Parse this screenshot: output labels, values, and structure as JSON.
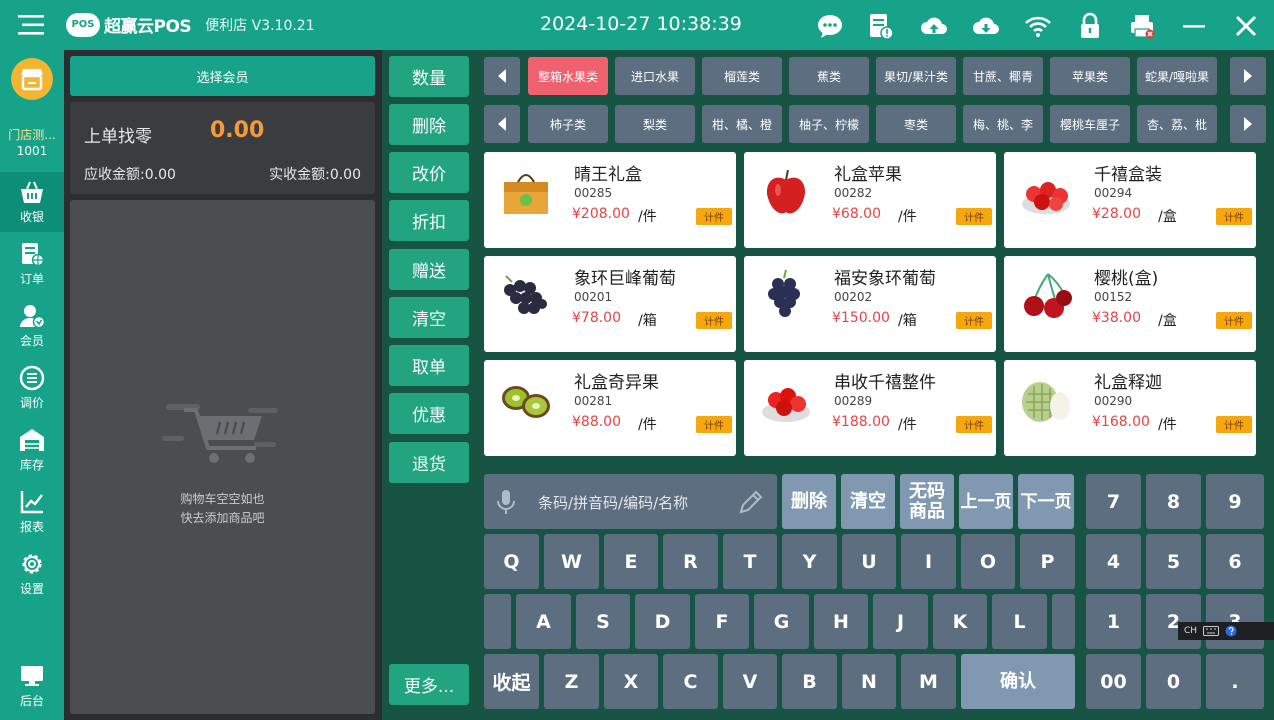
{
  "titlebar": {
    "logo_badge": "POS",
    "logo_text": "超赢云POS",
    "store_version": "便利店 V3.10.21",
    "datetime": "2024-10-27 10:38:39"
  },
  "sidebar": {
    "user_name": "门店测...",
    "user_id": "1001",
    "items": [
      {
        "label": "收银",
        "icon": "basket-icon",
        "active": true
      },
      {
        "label": "订单",
        "icon": "order-icon"
      },
      {
        "label": "会员",
        "icon": "member-icon"
      },
      {
        "label": "调价",
        "icon": "price-adjust-icon"
      },
      {
        "label": "库存",
        "icon": "warehouse-icon"
      },
      {
        "label": "报表",
        "icon": "chart-icon"
      },
      {
        "label": "设置",
        "icon": "gear-icon"
      },
      {
        "label": "后台",
        "icon": "monitor-icon"
      }
    ]
  },
  "left": {
    "member_button": "选择会员",
    "change_label": "上单找零",
    "change_value": "0.00",
    "due_amount": "应收金额:0.00",
    "paid_amount": "实收金额:0.00",
    "cart_empty_line1": "购物车空空如也",
    "cart_empty_line2": "快去添加商品吧"
  },
  "actions": [
    "数量",
    "删除",
    "改价",
    "折扣",
    "赠送",
    "清空",
    "取单",
    "优惠",
    "退货"
  ],
  "actions_more": "更多...",
  "categories_row1": [
    "整箱水果类",
    "进口水果",
    "榴莲类",
    "蕉类",
    "果切/果汁类",
    "甘蔗、椰青",
    "苹果类",
    "蛇果/嘎啦果"
  ],
  "categories_row2": [
    "柿子类",
    "梨类",
    "柑、橘、橙",
    "柚子、柠檬",
    "枣类",
    "梅、桃、李",
    "樱桃车厘子",
    "杏、荔、枇"
  ],
  "products": [
    {
      "name": "晴王礼盒",
      "code": "00285",
      "price": "¥208.00",
      "unit": "/件",
      "tag": "计件",
      "img": "giftbox-icon"
    },
    {
      "name": "礼盒苹果",
      "code": "00282",
      "price": "¥68.00",
      "unit": "/件",
      "tag": "计件",
      "img": "apple-icon"
    },
    {
      "name": "千禧盒装",
      "code": "00294",
      "price": "¥28.00",
      "unit": "/盒",
      "tag": "计件",
      "img": "tomato-icon"
    },
    {
      "name": "象环巨峰葡萄",
      "code": "00201",
      "price": "¥78.00",
      "unit": "/箱",
      "tag": "计件",
      "img": "grape-icon"
    },
    {
      "name": "福安象环葡萄",
      "code": "00202",
      "price": "¥150.00",
      "unit": "/箱",
      "tag": "计件",
      "img": "grape-bunch-icon"
    },
    {
      "name": "樱桃(盒)",
      "code": "00152",
      "price": "¥38.00",
      "unit": "/盒",
      "tag": "计件",
      "img": "cherry-icon"
    },
    {
      "name": "礼盒奇异果",
      "code": "00281",
      "price": "¥88.00",
      "unit": "/件",
      "tag": "计件",
      "img": "kiwi-icon"
    },
    {
      "name": "串收千禧整件",
      "code": "00289",
      "price": "¥188.00",
      "unit": "/件",
      "tag": "计件",
      "img": "tomato-bowl-icon"
    },
    {
      "name": "礼盒释迦",
      "code": "00290",
      "price": "¥168.00",
      "unit": "/件",
      "tag": "计件",
      "img": "sugar-apple-icon"
    }
  ],
  "search_placeholder": "条码/拼音码/编码/名称",
  "keypad": {
    "func": [
      "删除",
      "清空",
      "无码商品",
      "上一页",
      "下一页"
    ],
    "row_q": [
      "Q",
      "W",
      "E",
      "R",
      "T",
      "Y",
      "U",
      "I",
      "O",
      "P"
    ],
    "row_a": [
      "A",
      "S",
      "D",
      "F",
      "G",
      "H",
      "J",
      "K",
      "L"
    ],
    "row_z": [
      "Z",
      "X",
      "C",
      "V",
      "B",
      "N",
      "M"
    ],
    "collapse": "收起",
    "confirm": "确认",
    "num_rows": [
      [
        "7",
        "8",
        "9"
      ],
      [
        "4",
        "5",
        "6"
      ],
      [
        "1",
        "2",
        "3"
      ],
      [
        "00",
        "0",
        "."
      ]
    ]
  },
  "ime": "CH"
}
